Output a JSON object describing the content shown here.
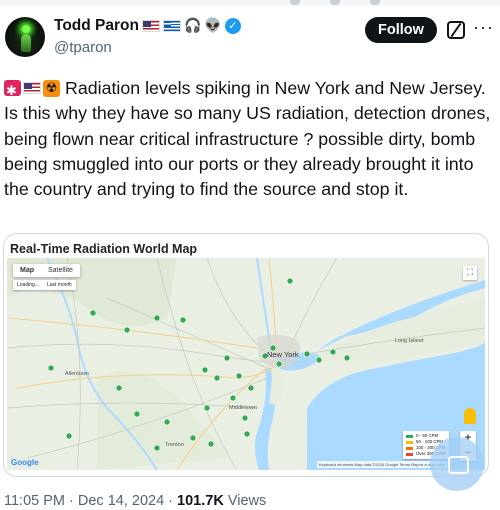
{
  "author": {
    "name": "Todd Paron",
    "handle": "@tparon",
    "flair": [
      "flag-united-states",
      "flag-greece",
      "headphones-icon",
      "alien-icon",
      "verified-badge"
    ]
  },
  "actions": {
    "follow_label": "Follow"
  },
  "tweet": {
    "lead_emojis": [
      "siren-icon",
      "flag-united-states",
      "radioactive-icon"
    ],
    "text": "Radiation levels spiking in New York and New Jersey. Is this why they have so many US radiation, detection drones, being flown near critical infrastructure ? possible dirty, bomb being smuggled into our ports or they already brought it into the country and trying to find the source and stop it."
  },
  "card": {
    "title": "Real-Time Radiation World Map",
    "map_toggle": [
      "Map",
      "Satellite"
    ],
    "map_toolbar": [
      "Loading...",
      "Last month"
    ],
    "legend": [
      {
        "label": "0 - 50 CPM",
        "color": "#34a853"
      },
      {
        "label": "50 - 100 CPM",
        "color": "#fbbc04"
      },
      {
        "label": "100 - 200 CPM",
        "color": "#ff6d01"
      },
      {
        "label": "Over 200 CPM",
        "color": "#ea4335"
      }
    ],
    "city_labels": [
      "New York",
      "Trenton",
      "Allentown",
      "Long Island",
      "Middletown"
    ],
    "footer": "Keyboard shortcuts   Map data ©2024 Google   Terms   Report a map error",
    "google_logo": "Google"
  },
  "meta": {
    "time": "11:05 PM · Dec 14, 2024 · ",
    "views_count": "101.7K",
    "views_label": " Views"
  }
}
